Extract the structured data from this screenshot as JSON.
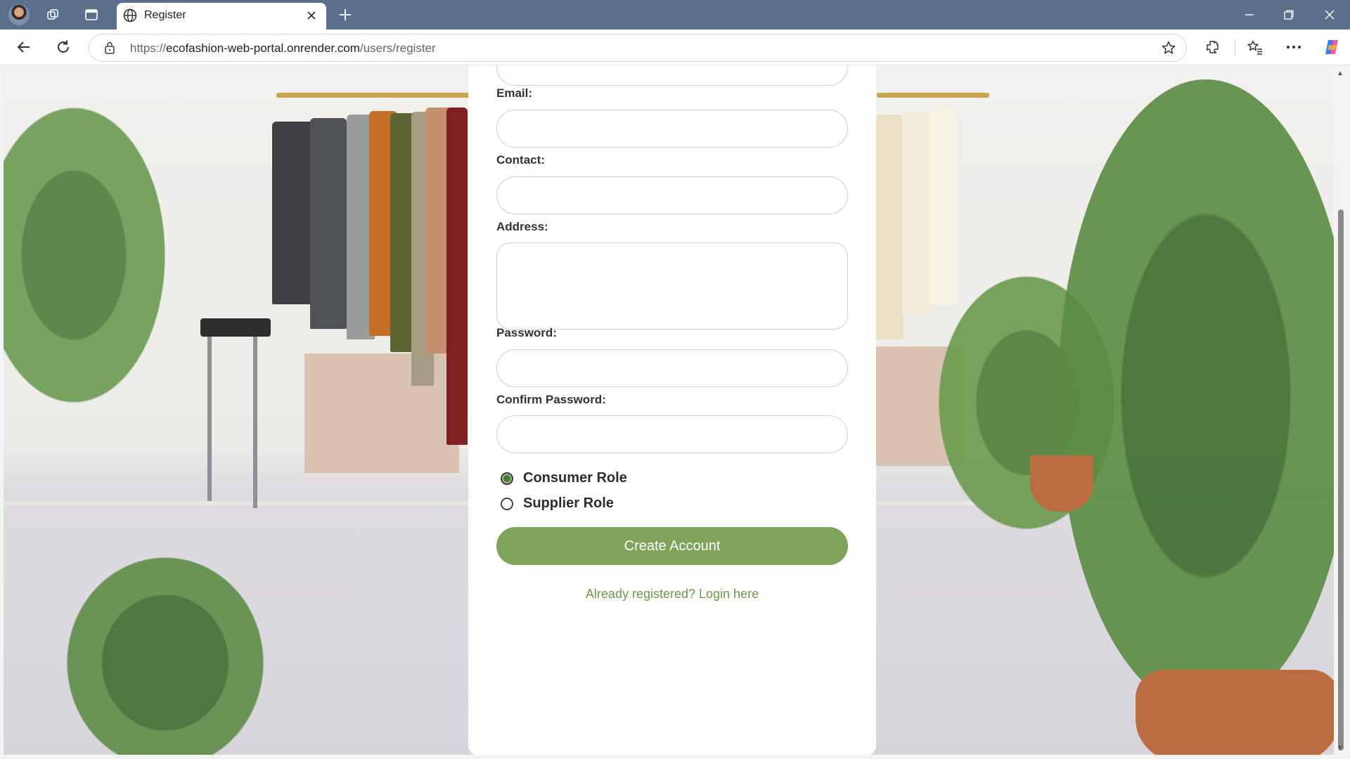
{
  "browser": {
    "tab_title": "Register",
    "url_prefix": "https://",
    "url_host": "ecofashion-web-portal.onrender.com",
    "url_path": "/users/register"
  },
  "form": {
    "email_label": "Email:",
    "contact_label": "Contact:",
    "address_label": "Address:",
    "password_label": "Password:",
    "confirm_password_label": "Confirm Password:",
    "roles": [
      {
        "label": "Consumer Role",
        "checked": true
      },
      {
        "label": "Supplier Role",
        "checked": false
      }
    ],
    "submit_label": "Create Account",
    "login_link": "Already registered? Login here"
  },
  "colors": {
    "accent": "#7fa35a",
    "link": "#6a9a4c",
    "titlebar": "#5c6f8a"
  }
}
